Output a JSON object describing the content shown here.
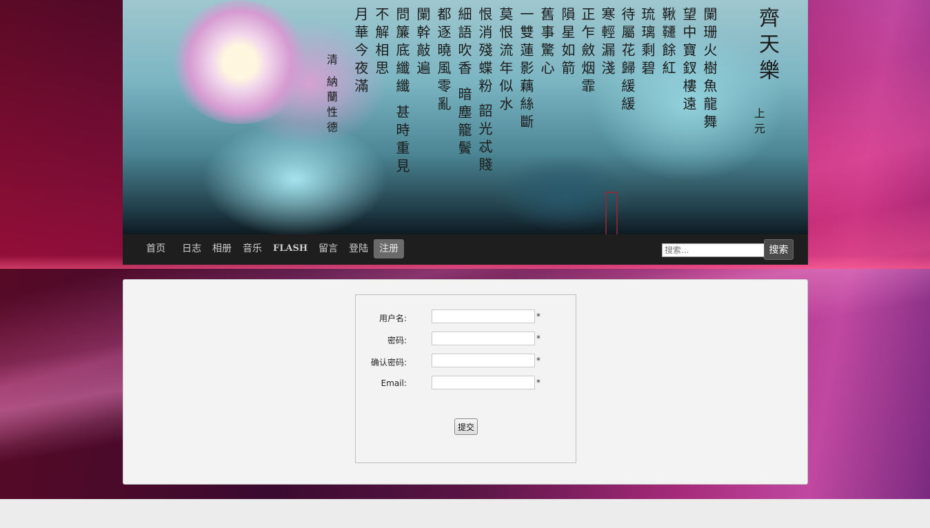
{
  "banner": {
    "poem_title": "齊天樂",
    "poem_subtitle": "上元",
    "poem_columns": [
      "闌珊火樹魚龍舞",
      "望中寶釵樓遠",
      "鞦韆餘紅",
      "琉璃剩碧",
      "待屬花歸緩緩",
      "寒輕漏淺",
      "正乍斂烟霏",
      "隕星如箭",
      "舊事驚心",
      "一雙蓮影藕絲斷",
      "莫恨流年似水",
      "恨消殘蝶粉",
      "韶光忒賤",
      "細語吹香",
      "暗塵籠鬢",
      "都逐曉風零亂",
      "闌幹敲遍",
      "問簾底纖纖",
      "甚時重見",
      "不解相思",
      "月華今夜滿"
    ],
    "author_dynasty": "清",
    "author_name": "納蘭性德"
  },
  "nav": {
    "items": [
      "首页",
      "日志",
      "相册",
      "音乐",
      "FLASH",
      "留言",
      "登陆",
      "注册"
    ],
    "active": "注册",
    "search_placeholder": "搜索...",
    "search_button": "搜索"
  },
  "form": {
    "fields": [
      {
        "label": "用户名:",
        "value": "",
        "required_mark": "*"
      },
      {
        "label": "密码:",
        "value": "",
        "required_mark": "*"
      },
      {
        "label": "确认密码:",
        "value": "",
        "required_mark": "*"
      },
      {
        "label": "Email:",
        "value": "",
        "required_mark": "*"
      }
    ],
    "submit_label": "提交"
  },
  "colors": {
    "nav_bg": "#1e1e1e",
    "nav_active_bg": "#6a6a6a",
    "panel_bg": "#f3f3f3"
  }
}
